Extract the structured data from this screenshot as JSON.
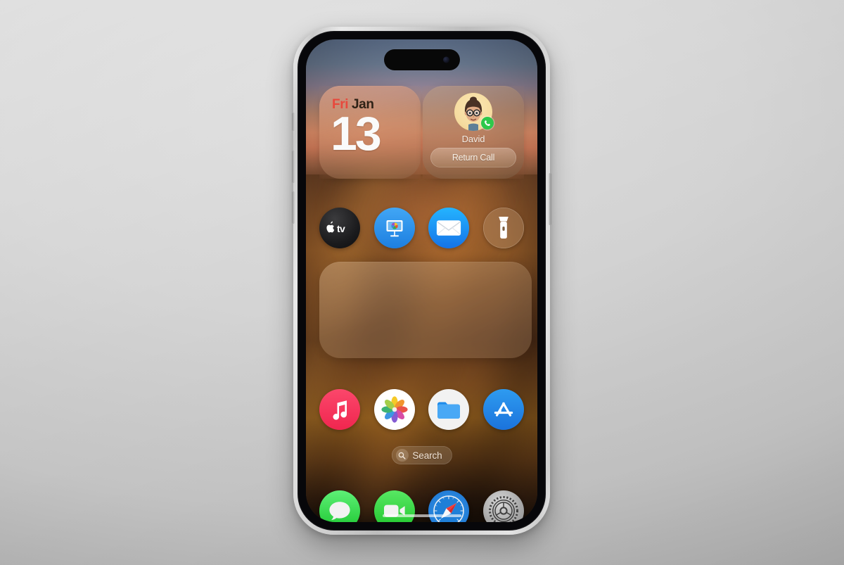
{
  "scene": {
    "description": "iPhone home screen mockup on light gray studio background",
    "background_color": "#d2d2d2"
  },
  "device": {
    "frame_color": "#cfcfcf",
    "buttons": [
      {
        "name": "action-button",
        "side": "left"
      },
      {
        "name": "volume-up-button",
        "side": "left"
      },
      {
        "name": "volume-down-button",
        "side": "left"
      },
      {
        "name": "power-button",
        "side": "right"
      }
    ],
    "dynamic_island": "dynamic-island"
  },
  "wallpaper": {
    "name": "desert-sunset-blurred",
    "sky_colors": [
      "#5d6f8b",
      "#c48c70",
      "#e2906a"
    ],
    "land_colors": [
      "#8a5526",
      "#95601f",
      "#1d1209"
    ]
  },
  "widgets": {
    "calendar": {
      "day_of_week": "Fri",
      "month": "Jan",
      "day_number": "13",
      "dow_color": "#e8483c",
      "month_color": "#2e2216",
      "day_color": "#fafafa"
    },
    "contact": {
      "name": "David",
      "avatar": "memoji-avatar",
      "status_badge": "phone-call-badge",
      "badge_color": "#2ec84b",
      "action_label": "Return Call"
    },
    "placeholder": {
      "label": ""
    }
  },
  "apps": {
    "row1": [
      {
        "id": "apple-tv",
        "label": "Apple TV"
      },
      {
        "id": "keynote",
        "label": "Keynote"
      },
      {
        "id": "mail",
        "label": "Mail"
      },
      {
        "id": "flashlight",
        "label": "Flashlight"
      }
    ],
    "row2": [
      {
        "id": "music",
        "label": "Music"
      },
      {
        "id": "photos",
        "label": "Photos"
      },
      {
        "id": "files",
        "label": "Files"
      },
      {
        "id": "app-store",
        "label": "App Store"
      }
    ],
    "dock": [
      {
        "id": "messages",
        "label": "Messages"
      },
      {
        "id": "facetime",
        "label": "FaceTime"
      },
      {
        "id": "safari",
        "label": "Safari"
      },
      {
        "id": "settings",
        "label": "Settings"
      }
    ]
  },
  "search": {
    "label": "Search",
    "icon": "magnifier-icon"
  }
}
